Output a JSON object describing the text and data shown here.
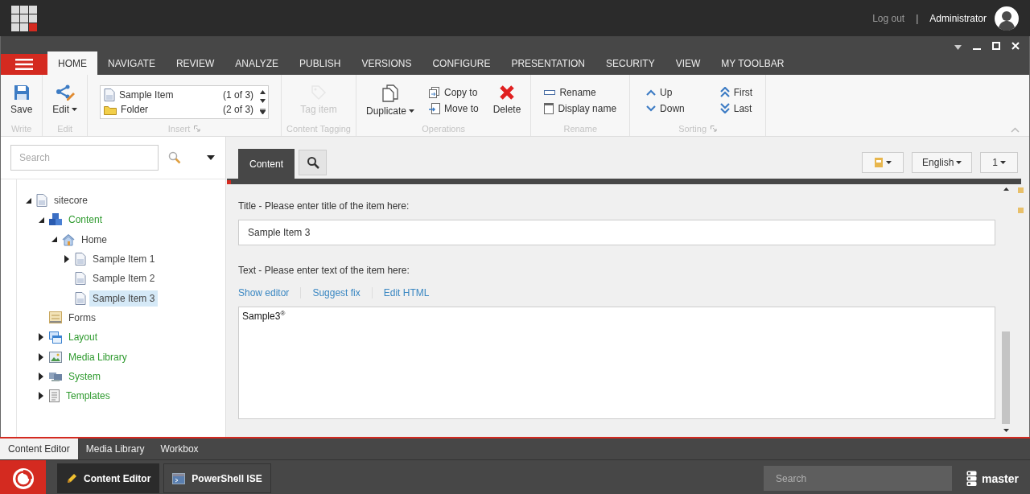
{
  "top_bar": {
    "logout": "Log out",
    "separator": "|",
    "user": "Administrator"
  },
  "ribbon": {
    "tabs": [
      {
        "label": "HOME",
        "selected": true
      },
      {
        "label": "NAVIGATE",
        "selected": false
      },
      {
        "label": "REVIEW",
        "selected": false
      },
      {
        "label": "ANALYZE",
        "selected": false
      },
      {
        "label": "PUBLISH",
        "selected": false
      },
      {
        "label": "VERSIONS",
        "selected": false
      },
      {
        "label": "CONFIGURE",
        "selected": false
      },
      {
        "label": "PRESENTATION",
        "selected": false
      },
      {
        "label": "SECURITY",
        "selected": false
      },
      {
        "label": "VIEW",
        "selected": false
      },
      {
        "label": "MY TOOLBAR",
        "selected": false
      }
    ],
    "groups": [
      {
        "kind": "write",
        "caption": "Write",
        "launcher": false,
        "buttons": [
          {
            "label": "Save",
            "dropdown": false,
            "disabled": false
          }
        ]
      },
      {
        "kind": "edit",
        "caption": "Edit",
        "launcher": false,
        "buttons": [
          {
            "label": "Edit",
            "dropdown": true,
            "disabled": false
          }
        ]
      },
      {
        "kind": "insert",
        "caption": "Insert",
        "launcher": true,
        "items": [
          {
            "label": "Sample Item",
            "count": "(1 of 3)"
          },
          {
            "label": "Folder",
            "count": "(2 of 3)"
          }
        ]
      },
      {
        "kind": "tagging",
        "caption": "Content Tagging",
        "launcher": false,
        "buttons": [
          {
            "label": "Tag item",
            "dropdown": false,
            "disabled": true
          }
        ]
      },
      {
        "kind": "operations",
        "caption": "Operations",
        "launcher": false,
        "buttons": [
          {
            "label": "Duplicate",
            "dropdown": true,
            "disabled": false
          },
          {
            "label": "Copy to",
            "dropdown": false,
            "disabled": false
          },
          {
            "label": "Move to",
            "dropdown": false,
            "disabled": false
          },
          {
            "label": "Delete",
            "dropdown": false,
            "disabled": false
          }
        ]
      },
      {
        "kind": "rename",
        "caption": "Rename",
        "launcher": false,
        "buttons": [
          {
            "label": "Rename",
            "dropdown": false,
            "disabled": false
          },
          {
            "label": "Display name",
            "dropdown": false,
            "disabled": false
          }
        ]
      },
      {
        "kind": "sorting",
        "caption": "Sorting",
        "launcher": true,
        "buttons": [
          {
            "label": "Up",
            "dropdown": false,
            "disabled": false
          },
          {
            "label": "Down",
            "dropdown": false,
            "disabled": false
          },
          {
            "label": "First",
            "dropdown": false,
            "disabled": false
          },
          {
            "label": "Last",
            "dropdown": false,
            "disabled": false
          }
        ]
      }
    ]
  },
  "tree_panel": {
    "search": {
      "placeholder": "Search"
    },
    "tree": [
      {
        "label": "sitecore",
        "kind": "page",
        "color": "#444444",
        "expanded": true,
        "selected": false,
        "children": [
          {
            "label": "Content",
            "kind": "content",
            "color": "#2e9a2e",
            "expanded": true,
            "selected": false,
            "children": [
              {
                "label": "Home",
                "kind": "home",
                "color": "#444444",
                "expanded": true,
                "selected": false,
                "children": [
                  {
                    "label": "Sample Item 1",
                    "kind": "page",
                    "color": "#444444",
                    "expanded": false,
                    "selected": false
                  },
                  {
                    "label": "Sample Item 2",
                    "kind": "page",
                    "color": "#444444",
                    "selected": false
                  },
                  {
                    "label": "Sample Item 3",
                    "kind": "page",
                    "color": "#444444",
                    "selected": true
                  }
                ]
              }
            ]
          },
          {
            "label": "Forms",
            "kind": "forms",
            "color": "#444444",
            "selected": false
          },
          {
            "label": "Layout",
            "kind": "layout",
            "color": "#2e9a2e",
            "expanded": false,
            "selected": false
          },
          {
            "label": "Media Library",
            "kind": "media",
            "color": "#2e9a2e",
            "expanded": false,
            "selected": false
          },
          {
            "label": "System",
            "kind": "system",
            "color": "#2e9a2e",
            "expanded": false,
            "selected": false
          },
          {
            "label": "Templates",
            "kind": "templates",
            "color": "#2e9a2e",
            "expanded": false,
            "selected": false
          }
        ]
      }
    ]
  },
  "editor": {
    "tabs": [
      {
        "label": "Content",
        "selected": true
      }
    ],
    "language": "English",
    "version": "1",
    "fields": [
      {
        "kind": "text",
        "label": "Title - Please enter title of the item here:",
        "value": "Sample Item 3"
      },
      {
        "kind": "rich_text",
        "label": "Text - Please enter text of the item here:",
        "links": [
          "Show editor",
          "Suggest fix",
          "Edit HTML"
        ],
        "value": "Sample3$^{®}$"
      }
    ]
  },
  "bottom_tabs": [
    {
      "label": "Content Editor",
      "selected": true
    },
    {
      "label": "Media Library",
      "selected": false
    },
    {
      "label": "Workbox",
      "selected": false
    }
  ],
  "taskbar": {
    "apps": [
      {
        "label": "Content Editor",
        "kind": "editor",
        "selected": true
      },
      {
        "label": "PowerShell ISE",
        "kind": "console",
        "selected": false
      }
    ],
    "search": {
      "placeholder": "Search"
    },
    "database": "master"
  }
}
